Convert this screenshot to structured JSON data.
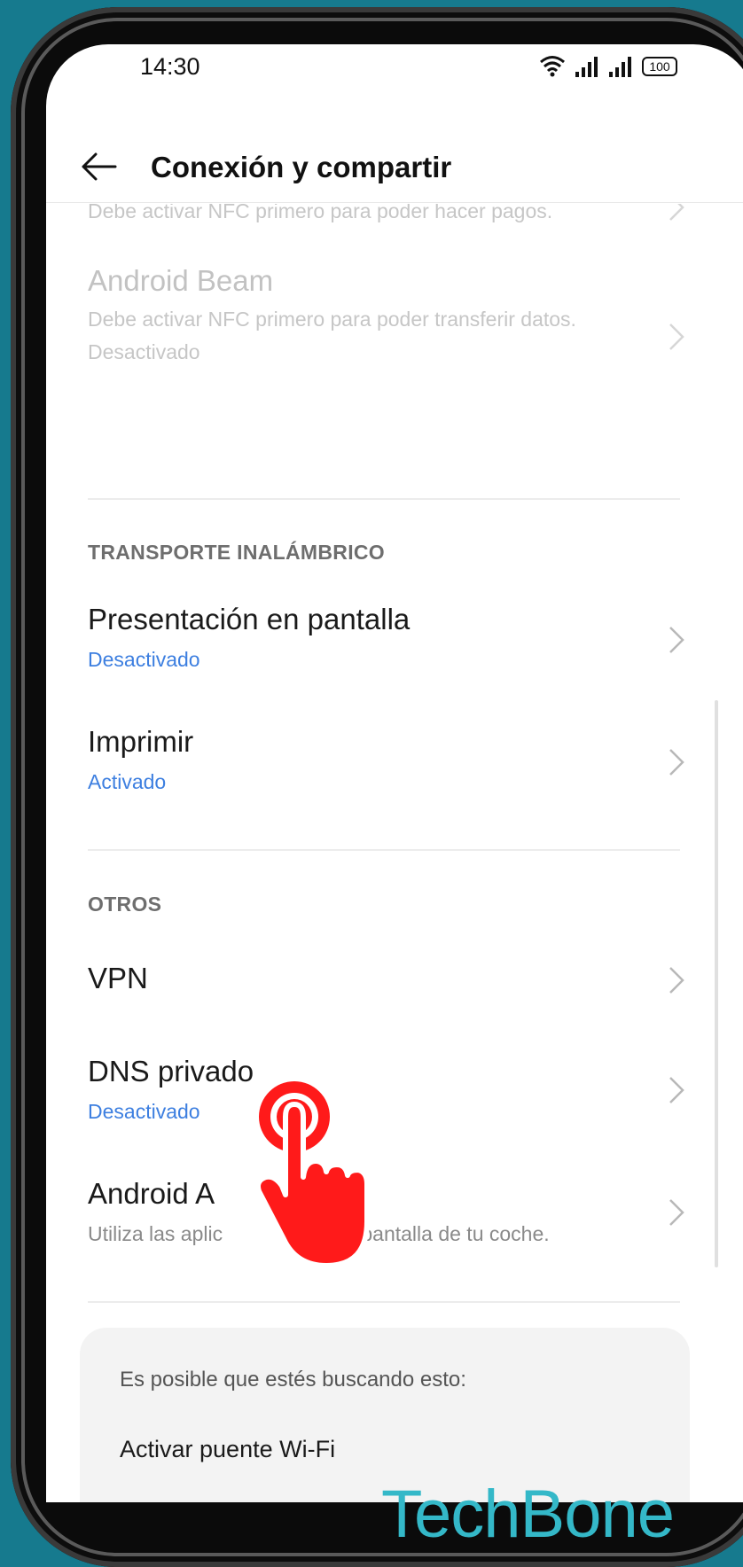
{
  "status_bar": {
    "time": "14:30",
    "battery": "100"
  },
  "header": {
    "title": "Conexión y compartir"
  },
  "items": {
    "pay_sub": "Debe activar NFC primero para poder hacer pagos.",
    "beam_title": "Android Beam",
    "beam_sub1": "Debe activar NFC primero para poder transferir datos.",
    "beam_sub2": "Desactivado"
  },
  "wireless": {
    "section": "TRANSPORTE INALÁMBRICO",
    "cast_title": "Presentación en pantalla",
    "cast_status": "Desactivado",
    "print_title": "Imprimir",
    "print_status": "Activado"
  },
  "others": {
    "section": "OTROS",
    "vpn_title": "VPN",
    "dns_title": "DNS privado",
    "dns_status": "Desactivado",
    "auto_title": "Android A",
    "auto_sub_start": "Utiliza las aplic",
    "auto_sub_end": "en la pantalla de tu coche."
  },
  "suggestions": {
    "label": "Es posible que estés buscando esto:",
    "item": "Activar puente Wi-Fi"
  },
  "watermark": "TechBone",
  "colors": {
    "accent": "#3d7fe0",
    "tap_indicator": "#ff1a1a",
    "background": "#167a8e",
    "watermark": "#34b8c8"
  }
}
